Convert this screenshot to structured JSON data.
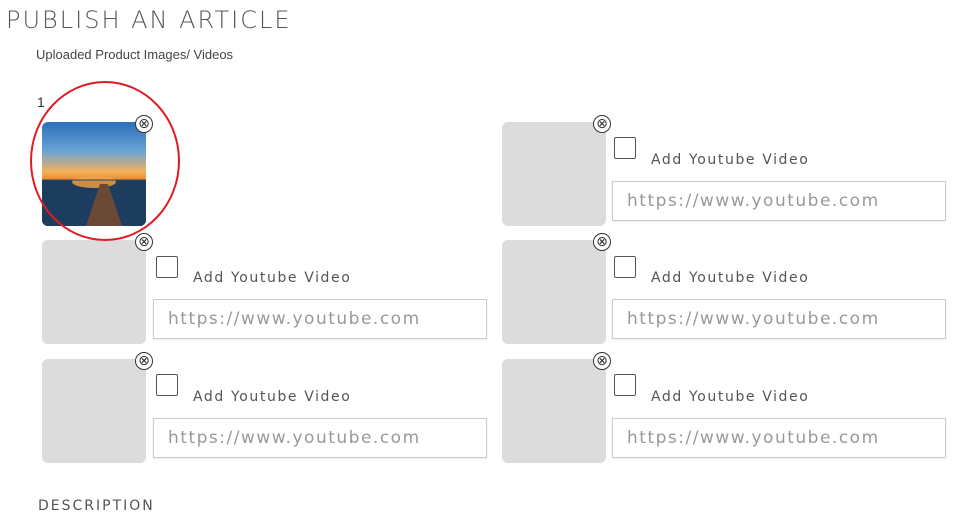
{
  "page": {
    "title": "PUBLISH AN ARTICLE",
    "subtitle": "Uploaded Product Images/ Videos",
    "index_label": "1",
    "next_section_label": "DESCRIPTION"
  },
  "media": {
    "remove_icon": "⊗",
    "checkbox_label": "Add Youtube Video",
    "url_placeholder": "https://www.youtube.com",
    "slots": [
      {
        "has_image": true,
        "image_desc": "sunset pier"
      },
      {
        "has_image": false
      },
      {
        "has_image": false
      },
      {
        "has_image": false
      },
      {
        "has_image": false
      },
      {
        "has_image": false
      }
    ]
  },
  "colors": {
    "highlight": "#e01b24",
    "placeholder_slot": "#dcdcdc"
  }
}
